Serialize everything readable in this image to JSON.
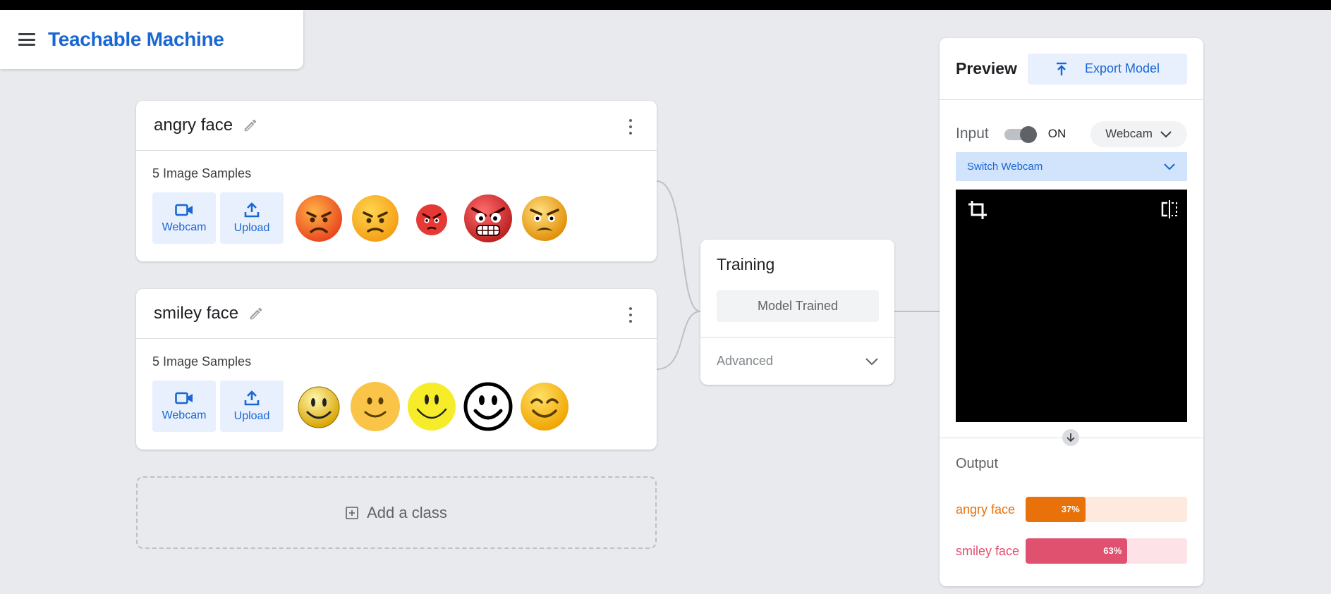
{
  "app": {
    "title": "Teachable Machine"
  },
  "classes": [
    {
      "name": "angry face",
      "sample_count": "5 Image Samples",
      "webcam_label": "Webcam",
      "upload_label": "Upload",
      "thumbnails": [
        "angry-emoji-icon",
        "annoyed-emoji-icon",
        "red-angry-emoji-icon",
        "furious-emoji-icon",
        "frustrated-emoji-icon"
      ]
    },
    {
      "name": "smiley face",
      "sample_count": "5 Image Samples",
      "webcam_label": "Webcam",
      "upload_label": "Upload",
      "thumbnails": [
        "smiley-emoji-icon",
        "smiling-face-icon",
        "yellow-smiley-icon",
        "outline-smiley-icon",
        "happy-emoji-icon"
      ]
    }
  ],
  "add_class": {
    "label": "Add a class"
  },
  "training": {
    "title": "Training",
    "status": "Model Trained",
    "advanced_label": "Advanced"
  },
  "preview": {
    "title": "Preview",
    "export_label": "Export Model",
    "input_label": "Input",
    "input_state": "ON",
    "source_selected": "Webcam",
    "switch_webcam_label": "Switch Webcam",
    "output_title": "Output",
    "outputs": [
      {
        "label": "angry face",
        "percent": 37,
        "percent_label": "37%",
        "color": "#e8710a",
        "bg": "#fde9de"
      },
      {
        "label": "smiley face",
        "percent": 63,
        "percent_label": "63%",
        "color": "#e0506f",
        "bg": "#fde3e8"
      }
    ]
  },
  "colors": {
    "accent": "#1967d2",
    "background": "#e8eaed"
  }
}
